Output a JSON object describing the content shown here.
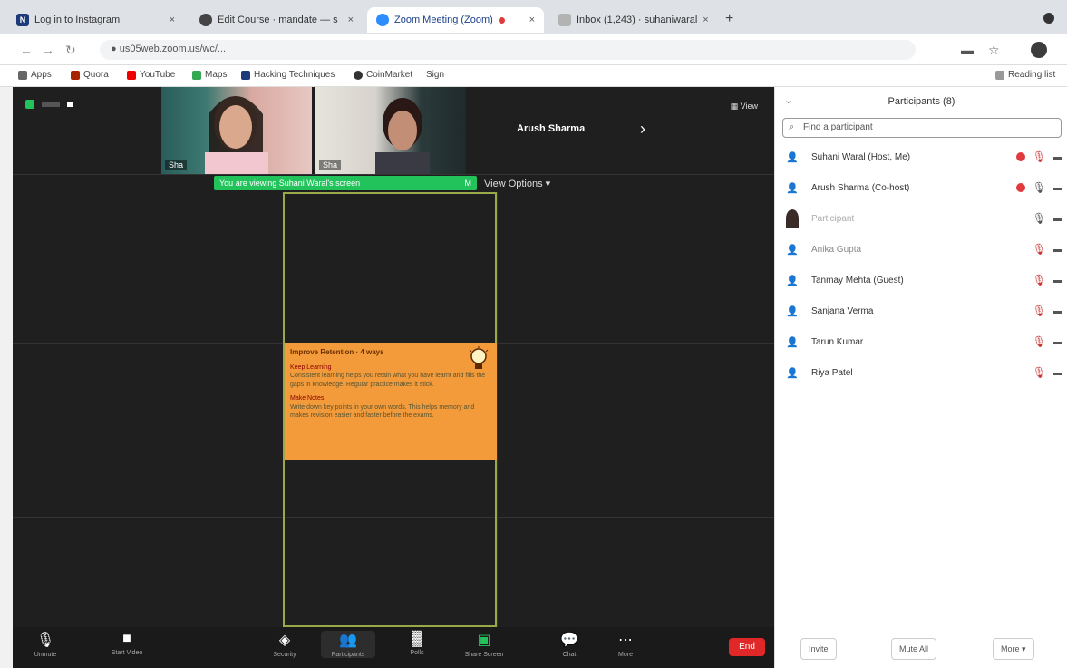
{
  "browser": {
    "tabs": [
      {
        "label": "Log in to Instagram",
        "favicon_color": "#1d3b7a"
      },
      {
        "label": "Edit Course · mandate — s",
        "favicon_color": "#444444"
      },
      {
        "label": "Zoom Meeting (Zoom)",
        "favicon_color": "#2d8cff"
      },
      {
        "label": "Inbox (1,243) · suhaniwaral",
        "favicon_color": "#b3b3b3"
      }
    ],
    "new_tab_label": "+",
    "url": "us05web.zoom.us/wc/...",
    "bookmarks": [
      "Apps",
      "Quora",
      "YouTube",
      "Maps",
      "Hacking Techniques",
      "CoinMarket",
      "Sign"
    ],
    "reading_list": "Reading list"
  },
  "meeting": {
    "thumbnails": [
      {
        "name": "Sha"
      },
      {
        "name": "Sha"
      }
    ],
    "speaker_name": "Arush Sharma",
    "view_label": "View",
    "share_banner": "You are viewing Suhani Waral's screen",
    "share_banner_extra": "M",
    "view_options": "View Options",
    "slide": {
      "title": "Improve Retention · 4 ways",
      "heading1": "Keep Learning",
      "body1": "Consistent learning helps you retain what you have learnt and fills the gaps in knowledge. Regular practice makes it stick.",
      "heading2": "Make Notes",
      "body2": "Write down key points in your own words. This helps memory and makes revision easier and faster before the exams."
    },
    "toolbar": [
      {
        "label": "Unmute",
        "icon": "mic-icon",
        "glyph": "🎙"
      },
      {
        "label": "Start Video",
        "icon": "video-icon",
        "glyph": "■"
      },
      {
        "label": "Security",
        "icon": "shield-icon",
        "glyph": "◈"
      },
      {
        "label": "Participants",
        "icon": "people-icon",
        "glyph": "👥"
      },
      {
        "label": "Polls",
        "icon": "poll-icon",
        "glyph": "▓"
      },
      {
        "label": "Share Screen",
        "icon": "share-icon",
        "glyph": "▣"
      },
      {
        "label": "Chat",
        "icon": "chat-icon",
        "glyph": "💬"
      },
      {
        "label": "More",
        "icon": "more-icon",
        "glyph": "⋯"
      }
    ],
    "end_label": "End"
  },
  "participants": {
    "title": "Participants (8)",
    "search_placeholder": "Find a participant",
    "list": [
      {
        "name": "Suhani Waral (Host, Me)",
        "recording": true,
        "mic": "muted",
        "avatar": "person-icon"
      },
      {
        "name": "Arush Sharma (Co-host)",
        "recording": true,
        "mic": "on",
        "avatar": "person-icon"
      },
      {
        "name": "Participant",
        "recording": false,
        "mic": "on",
        "avatar": "photo"
      },
      {
        "name": "Anika Gupta",
        "recording": false,
        "mic": "muted",
        "avatar": "person-icon"
      },
      {
        "name": "Tanmay Mehta (Guest)",
        "recording": false,
        "mic": "muted",
        "avatar": "person-icon"
      },
      {
        "name": "Sanjana Verma",
        "recording": false,
        "mic": "muted",
        "avatar": "person-icon"
      },
      {
        "name": "Tarun Kumar",
        "recording": false,
        "mic": "muted",
        "avatar": "person-icon"
      },
      {
        "name": "Riya Patel",
        "recording": false,
        "mic": "muted",
        "avatar": "person-icon"
      }
    ],
    "footer": [
      "Invite",
      "Mute All",
      "More"
    ]
  },
  "colors": {
    "accent": "#2d8cff",
    "end": "#e02828",
    "banner": "#23c35c",
    "slide": "#f39a3b"
  }
}
